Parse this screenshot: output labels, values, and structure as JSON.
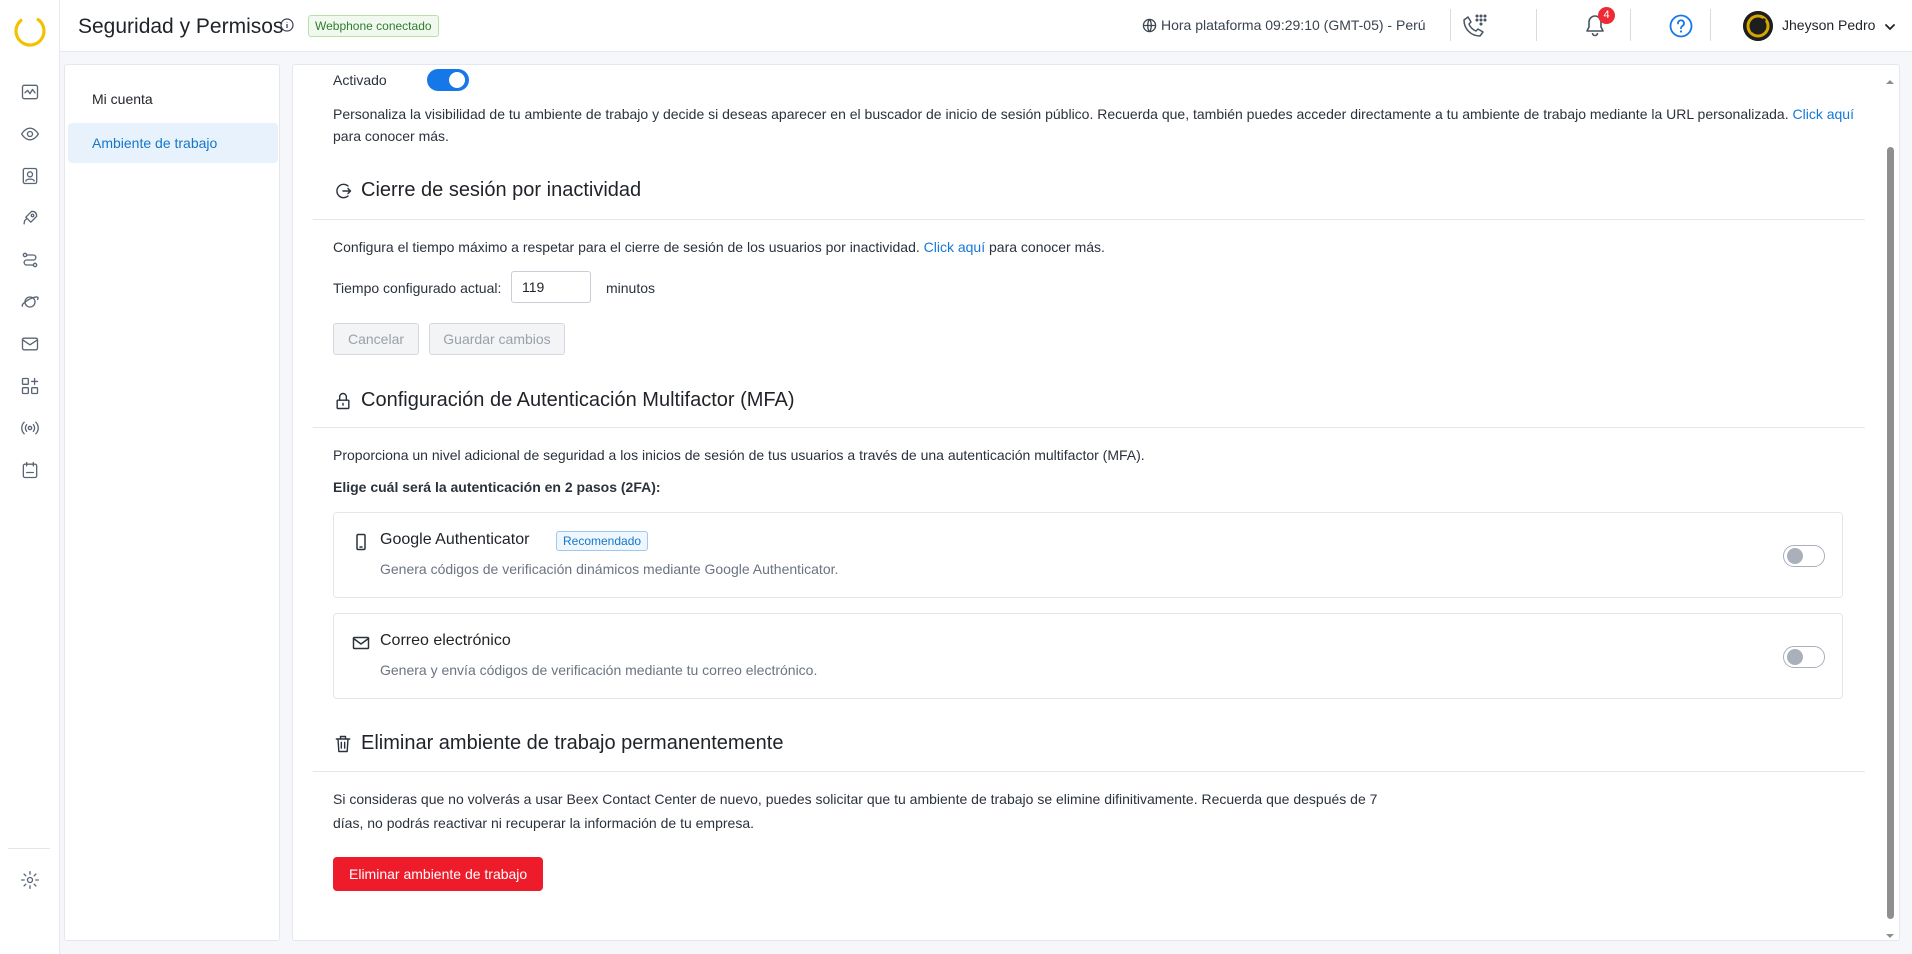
{
  "header": {
    "title": "Seguridad y Permisos",
    "webphone_badge": "Webphone conectado",
    "platform_time": "Hora plataforma 09:29:10 (GMT-05) - Perú",
    "notification_count": "4",
    "user_name": "Jheyson Pedro"
  },
  "rail": {
    "icons": [
      "dashboard-icon",
      "monitor-eye-icon",
      "contacts-icon",
      "campaigns-rocket-icon",
      "routing-icon",
      "planet-icon",
      "mail-icon",
      "apps-icon",
      "broadcast-icon",
      "calendar-icon",
      "settings-icon"
    ]
  },
  "sidebar": {
    "items": [
      {
        "label": "Mi cuenta",
        "active": false
      },
      {
        "label": "Ambiente de trabajo",
        "active": true
      }
    ]
  },
  "visibility": {
    "toggle_label": "Activado",
    "toggle_on": true,
    "description": "Personaliza la visibilidad de tu ambiente de trabajo y decide si deseas aparecer en el buscador de inicio de sesión público. Recuerda que, también puedes acceder directamente a tu ambiente de trabajo mediante la URL personalizada.",
    "link": "Click aquí",
    "suffix": "para conocer más."
  },
  "inactivity": {
    "title": "Cierre de sesión por inactividad",
    "description": "Configura el tiempo máximo a respetar para el cierre de sesión de los usuarios por inactividad.",
    "link": "Click aquí",
    "suffix": "para conocer más.",
    "field_label": "Tiempo configurado actual:",
    "field_value": "119",
    "unit": "minutos",
    "cancel_label": "Cancelar",
    "save_label": "Guardar cambios"
  },
  "mfa": {
    "title": "Configuración de Autenticación Multifactor (MFA)",
    "description": "Proporciona un nivel adicional de seguridad a los inicios de sesión de tus usuarios a través de una autenticación multifactor (MFA).",
    "choose_label": "Elige cuál será la autenticación en 2 pasos (2FA):",
    "options": [
      {
        "title": "Google Authenticator",
        "tag": "Recomendado",
        "description": "Genera códigos de verificación dinámicos mediante Google Authenticator.",
        "enabled": false
      },
      {
        "title": "Correo electrónico",
        "description": "Genera y envía códigos de verificación mediante tu correo electrónico.",
        "enabled": false
      }
    ]
  },
  "delete": {
    "title": "Eliminar ambiente de trabajo permanentemente",
    "description_line1": "Si consideras que no volverás a usar Beex Contact Center de nuevo, puedes solicitar que tu ambiente de trabajo se elimine difinitivamente. Recuerda que después de 7",
    "description_line2": "días, no podrás reactivar ni recuperar la información de tu empresa.",
    "button_label": "Eliminar ambiente de trabajo"
  },
  "colors": {
    "primary": "#1677e8",
    "danger": "#ee1c2a",
    "accent_logo": "#f2c200"
  }
}
